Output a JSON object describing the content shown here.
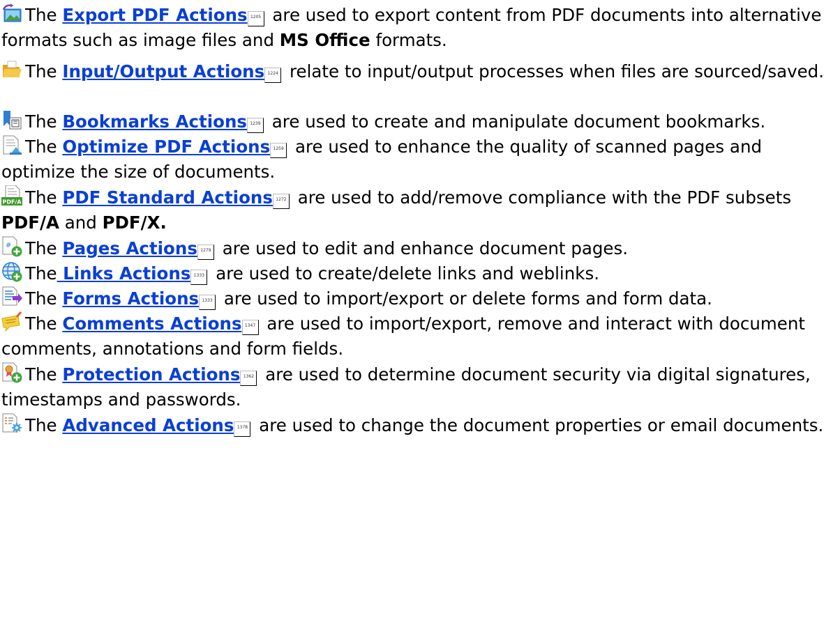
{
  "entries": [
    {
      "icon": "export-image-icon",
      "lead": "The ",
      "link": "Export PDF Actions",
      "page": "1205",
      "before_bold": " are used to export content from PDF documents into alternative formats such as image files and ",
      "bold1": "MS Office",
      "mid": " formats.",
      "bold2": "",
      "tail": ""
    },
    {
      "icon": "folder-icon",
      "lead": "The ",
      "link": "Input/Output Actions",
      "page": "1224",
      "before_bold": " relate to input/output processes when files are sourced/saved.",
      "bold1": "",
      "mid": "",
      "bold2": "",
      "tail": ""
    },
    {
      "icon": "bookmark-icon",
      "lead": "The ",
      "link": "Bookmarks Actions",
      "page": "1239",
      "before_bold": " are used to create and manipulate document bookmarks.",
      "bold1": "",
      "mid": "",
      "bold2": "",
      "tail": ""
    },
    {
      "icon": "optimize-icon",
      "lead": "The ",
      "link": "Optimize PDF Actions",
      "page": "1259",
      "before_bold": " are used to enhance the quality of scanned pages and optimize the size of documents.",
      "bold1": "",
      "mid": "",
      "bold2": "",
      "tail": ""
    },
    {
      "icon": "pdfa-icon",
      "icon_text": "PDF/A",
      "lead": "The ",
      "link": "PDF Standard Actions",
      "page": "1272",
      "before_bold": " are used to add/remove compliance with the PDF subsets ",
      "bold1": "PDF/A",
      "mid": " and ",
      "bold2": "PDF/X.",
      "tail": ""
    },
    {
      "icon": "page-add-icon",
      "lead": "The ",
      "link": "Pages Actions",
      "page": "1279",
      "before_bold": " are used to edit and enhance document pages.",
      "bold1": "",
      "mid": "",
      "bold2": "",
      "tail": ""
    },
    {
      "icon": "globe-link-icon",
      "lead": "The",
      "link": " Links Actions",
      "page": "1333",
      "before_bold": " are used to create/delete links and weblinks.",
      "bold1": "",
      "mid": "",
      "bold2": "",
      "tail": ""
    },
    {
      "icon": "form-arrow-icon",
      "lead": "The ",
      "link": "Forms Actions",
      "page": "1333",
      "before_bold": " are used to import/export or delete forms and form data.",
      "bold1": "",
      "mid": "",
      "bold2": "",
      "tail": ""
    },
    {
      "icon": "comment-note-icon",
      "lead": "The ",
      "link": "Comments Actions",
      "page": "1347",
      "before_bold": " are used to import/export, remove and interact with document comments, annotations and form fields.",
      "bold1": "",
      "mid": "",
      "bold2": "",
      "tail": ""
    },
    {
      "icon": "certificate-icon",
      "lead": "The ",
      "link": "Protection Actions",
      "page": "1362",
      "before_bold": " are used to determine document security via digital signatures, timestamps and passwords.",
      "bold1": "",
      "mid": "",
      "bold2": "",
      "tail": ""
    },
    {
      "icon": "settings-doc-icon",
      "lead": "The ",
      "link": "Advanced Actions",
      "page": "1378",
      "before_bold": " are used to change the document properties or email documents.",
      "bold1": "",
      "mid": "",
      "bold2": "",
      "tail": ""
    }
  ]
}
